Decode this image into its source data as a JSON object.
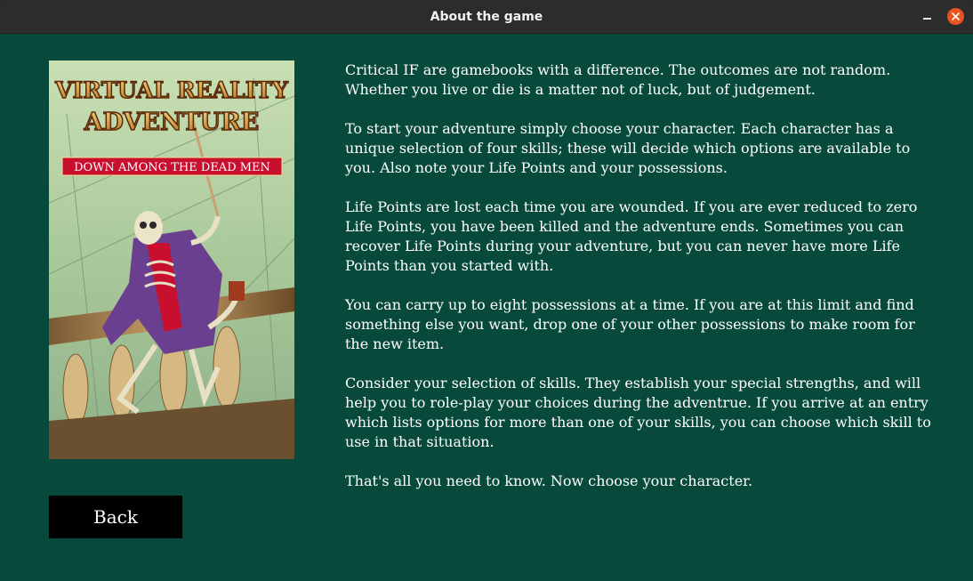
{
  "window": {
    "title": "About the game"
  },
  "cover": {
    "series_title_line1": "VIRTUAL REALITY",
    "series_title_line2": "ADVENTURE",
    "book_title": "DOWN AMONG THE DEAD MEN",
    "colors": {
      "banner": "#c8102e",
      "title_gold": "#e0a233",
      "sky": "#b9d3a4"
    }
  },
  "buttons": {
    "back_label": "Back"
  },
  "content": {
    "paragraphs": [
      "Critical IF are gamebooks with a difference. The outcomes are not random. Whether you live or die is a matter not of luck, but of judgement.",
      "To start your adventure simply choose your character. Each character has a unique selection of four skills; these will decide which options are available to you. Also note your Life Points and your possessions.",
      "Life Points are lost each time you are wounded. If you are ever reduced to zero Life Points, you have been killed and the adventure ends. Sometimes you can recover Life Points during your adventure, but you can never have more Life Points than you started with.",
      "You can carry up to eight possessions at a time. If you are at this limit and find something else you want, drop one of your other possessions to make room for the new item.",
      "Consider your selection of skills. They establish your special strengths, and will help you to role-play your choices during the adventrue. If you arrive at an entry which lists options for more than one of your skills, you can choose which skill to use in that situation.",
      "That's all you need to know. Now choose your character."
    ]
  },
  "theme": {
    "background": "#074a3c",
    "titlebar": "#2c2c2c",
    "close_button": "#e95420",
    "text": "#ffffff"
  }
}
